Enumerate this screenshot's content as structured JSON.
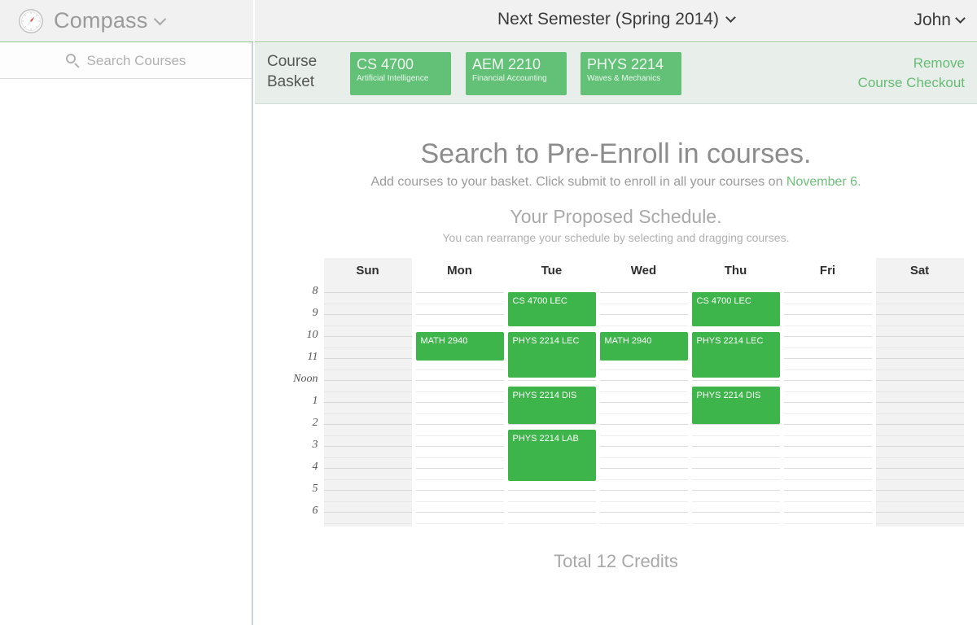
{
  "brand": {
    "name": "Compass",
    "icon": "compass-icon"
  },
  "search": {
    "placeholder": "Search Courses",
    "icon": "search-icon"
  },
  "topbar": {
    "semester": "Next Semester (Spring 2014)",
    "user": "John"
  },
  "basket": {
    "label": "Course\nBasket",
    "label_line1": "Course",
    "label_line2": "Basket",
    "courses": [
      {
        "code": "CS 4700",
        "title": "Artificial Intelligence"
      },
      {
        "code": "AEM 2210",
        "title": "Financial Accounting"
      },
      {
        "code": "PHYS 2214",
        "title": "Waves & Mechanics"
      }
    ],
    "actions": [
      "Remove",
      "Course Checkout"
    ]
  },
  "main": {
    "heading": "Search to Pre-Enroll in courses.",
    "sub_pre": "Add courses to your basket. Click submit to enroll in all your courses on ",
    "sub_accent": "November 6.",
    "schedule_heading": "Your Proposed Schedule.",
    "schedule_sub": "You can rearrange your schedule by selecting and dragging courses.",
    "total_credits": "Total 12 Credits"
  },
  "schedule": {
    "times": [
      "8",
      "9",
      "10",
      "11",
      "Noon",
      "1",
      "2",
      "3",
      "4",
      "5",
      "6"
    ],
    "days": [
      "Sun",
      "Mon",
      "Tue",
      "Wed",
      "Thu",
      "Fri",
      "Sat"
    ],
    "weekend_days": [
      "Sun",
      "Sat"
    ],
    "events": [
      {
        "day": "Tue",
        "label": "CS 4700 LEC",
        "start": 8.0,
        "end": 9.55
      },
      {
        "day": "Tue",
        "label": "PHYS 2214 LEC",
        "start": 9.8,
        "end": 11.9
      },
      {
        "day": "Tue",
        "label": "PHYS 2214 DIS",
        "start": 12.3,
        "end": 14.0
      },
      {
        "day": "Tue",
        "label": "PHYS 2214 LAB",
        "start": 14.25,
        "end": 16.6
      },
      {
        "day": "Thu",
        "label": "CS 4700 LEC",
        "start": 8.0,
        "end": 9.55
      },
      {
        "day": "Thu",
        "label": "PHYS 2214 LEC",
        "start": 9.8,
        "end": 11.9
      },
      {
        "day": "Thu",
        "label": "PHYS 2214 DIS",
        "start": 12.3,
        "end": 14.0
      },
      {
        "day": "Mon",
        "label": "MATH 2940",
        "start": 9.8,
        "end": 11.1
      },
      {
        "day": "Wed",
        "label": "MATH 2940",
        "start": 9.8,
        "end": 11.1
      }
    ]
  },
  "colors": {
    "event_green": "#3db54a",
    "chip_green": "#62c177",
    "accent_green": "#6dc078",
    "basket_bg": "#e8efea"
  }
}
